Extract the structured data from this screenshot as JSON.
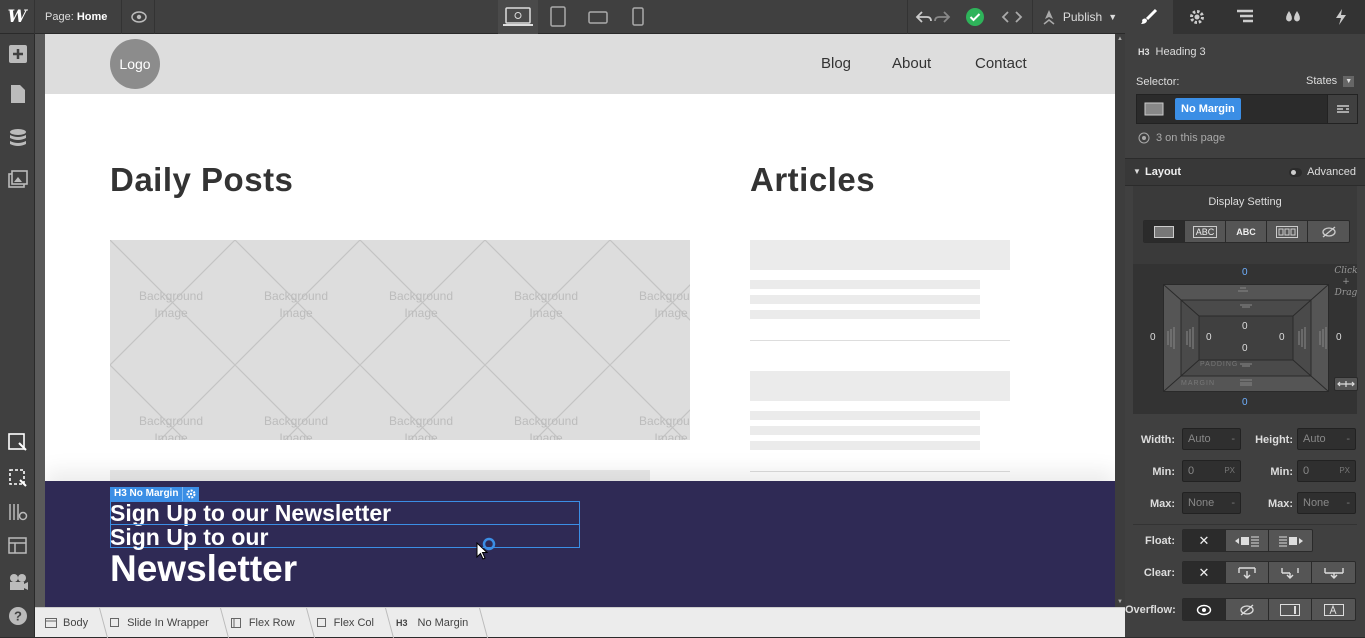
{
  "topbar": {
    "logo": "W",
    "page_prefix": "Page:",
    "page_name": "Home",
    "publish_label": "Publish"
  },
  "canvas": {
    "nav": {
      "logo": "Logo",
      "links": [
        "Blog",
        "About",
        "Contact"
      ]
    },
    "headings": {
      "left": "Daily Posts",
      "right": "Articles"
    },
    "bg_image_text": [
      "Background",
      "Image"
    ],
    "newsletter": {
      "selection_tag": "H3 No Margin",
      "heading_1": "Sign Up to our Newsletter",
      "heading_2_line1": "Sign Up to our",
      "heading_2_line2": "Newsletter"
    }
  },
  "breadcrumb": [
    "Body",
    "Slide In Wrapper",
    "Flex Row",
    "Flex Col",
    "No Margin"
  ],
  "breadcrumb_last_prefix": "H3",
  "panel": {
    "element_tag": "H3",
    "element_name": "Heading 3",
    "selector_label": "Selector:",
    "states_label": "States",
    "selector_class": "No Margin",
    "count_text": "3 on this page",
    "layout_title": "Layout",
    "advanced_label": "Advanced",
    "display_setting": "Display Setting",
    "display_options": [
      "ABC",
      "ABC"
    ],
    "hint": "Click + Drag",
    "box": {
      "margin_top": "0",
      "margin_bottom": "0",
      "margin_left": "0",
      "margin_right": "0",
      "padding_top": "0",
      "padding_bottom": "0",
      "padding_left": "0",
      "padding_right": "0",
      "padding_label": "PADDING",
      "margin_label": "MARGIN"
    },
    "size": {
      "width_label": "Width:",
      "width_val": "Auto",
      "height_label": "Height:",
      "height_val": "Auto",
      "min_label": "Min:",
      "min_w": "0",
      "min_h": "0",
      "unit": "PX",
      "max_label": "Max:",
      "max_w": "None",
      "max_h": "None"
    },
    "float_label": "Float:",
    "clear_label": "Clear:",
    "overflow_label": "Overflow:"
  },
  "colors": {
    "accent": "#3b8ee5",
    "newsletter_bg": "#2f2a55",
    "publish_check": "#2eb35a"
  }
}
